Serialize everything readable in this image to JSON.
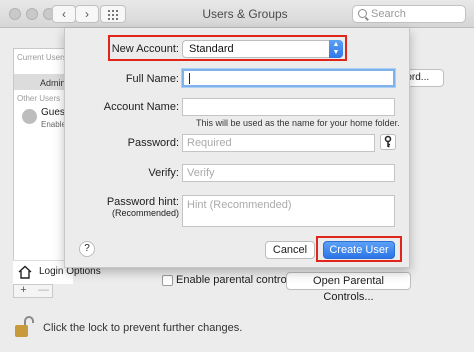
{
  "window": {
    "title": "Users & Groups"
  },
  "toolbar": {
    "back": "‹",
    "forward": "›",
    "search_placeholder": "Search"
  },
  "sidebar": {
    "current_users_header": "Current Users",
    "admin_label": "Admin",
    "other_users_header": "Other Users",
    "guest_name": "Guest",
    "guest_sub": "Enable",
    "login_options": "Login Options",
    "add": "+",
    "remove": "—"
  },
  "background": {
    "right_button": "...ord...",
    "parental_label": "Enable parental controls",
    "parental_button": "Open Parental Controls...",
    "lock_text": "Click the lock to prevent further changes."
  },
  "sheet": {
    "new_account_label": "New Account:",
    "new_account_value": "Standard",
    "full_name_label": "Full Name:",
    "full_name_value": "",
    "account_name_label": "Account Name:",
    "account_name_value": "",
    "account_name_help": "This will be used as the name for your home folder.",
    "password_label": "Password:",
    "password_placeholder": "Required",
    "verify_label": "Verify:",
    "verify_placeholder": "Verify",
    "hint_label": "Password hint:",
    "hint_sublabel": "(Recommended)",
    "hint_placeholder": "Hint (Recommended)",
    "help": "?",
    "cancel": "Cancel",
    "create": "Create User"
  },
  "colors": {
    "accent": "#2f78e8",
    "highlight": "#e0251b"
  }
}
